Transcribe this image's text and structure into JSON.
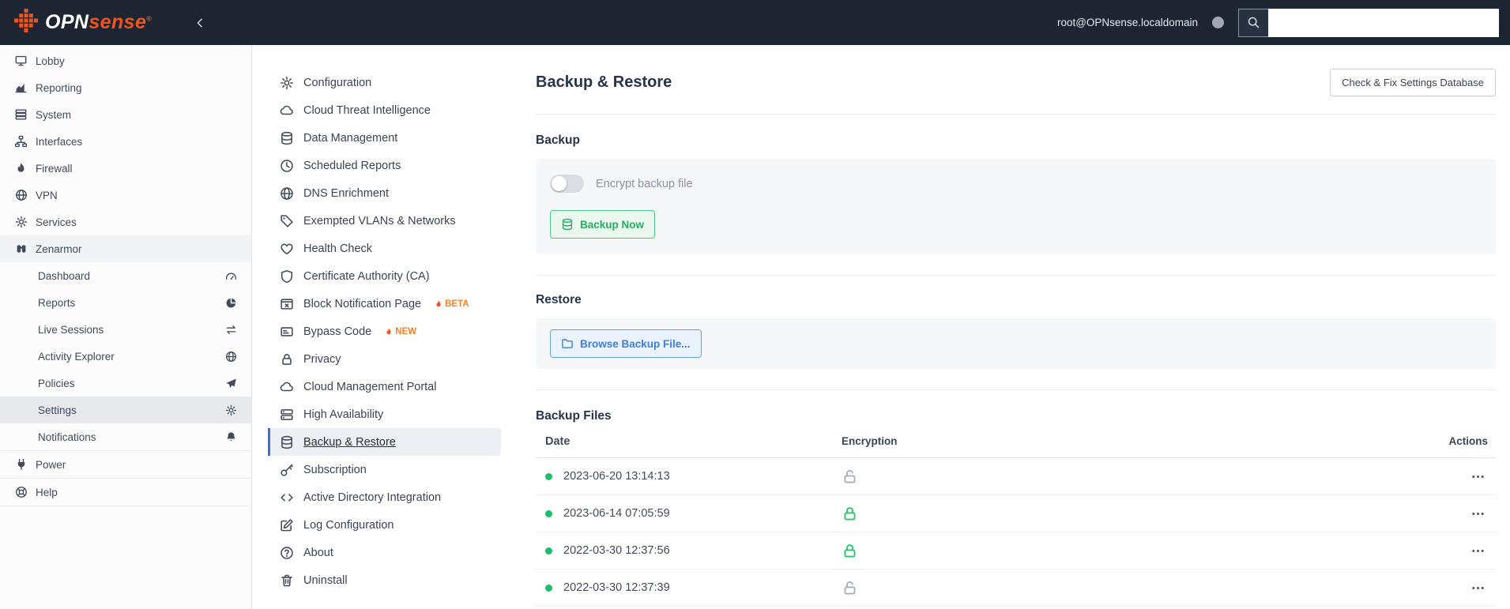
{
  "topbar": {
    "logo_opn": "OPN",
    "logo_sense": "sense",
    "logo_reg": "®",
    "user": "root@OPNsense.localdomain"
  },
  "sidebar": {
    "items": [
      {
        "label": "Lobby"
      },
      {
        "label": "Reporting"
      },
      {
        "label": "System"
      },
      {
        "label": "Interfaces"
      },
      {
        "label": "Firewall"
      },
      {
        "label": "VPN"
      },
      {
        "label": "Services"
      },
      {
        "label": "Zenarmor"
      },
      {
        "label": "Power"
      },
      {
        "label": "Help"
      }
    ],
    "zenarmor_children": [
      {
        "label": "Dashboard"
      },
      {
        "label": "Reports"
      },
      {
        "label": "Live Sessions"
      },
      {
        "label": "Activity Explorer"
      },
      {
        "label": "Policies"
      },
      {
        "label": "Settings"
      },
      {
        "label": "Notifications"
      }
    ]
  },
  "settings_menu": {
    "items": [
      {
        "label": "Configuration"
      },
      {
        "label": "Cloud Threat Intelligence"
      },
      {
        "label": "Data Management"
      },
      {
        "label": "Scheduled Reports"
      },
      {
        "label": "DNS Enrichment"
      },
      {
        "label": "Exempted VLANs & Networks"
      },
      {
        "label": "Health Check"
      },
      {
        "label": "Certificate Authority (CA)"
      },
      {
        "label": "Block Notification Page",
        "badge": "BETA"
      },
      {
        "label": "Bypass Code",
        "badge": "NEW"
      },
      {
        "label": "Privacy"
      },
      {
        "label": "Cloud Management Portal"
      },
      {
        "label": "High Availability"
      },
      {
        "label": "Backup & Restore"
      },
      {
        "label": "Subscription"
      },
      {
        "label": "Active Directory Integration"
      },
      {
        "label": "Log Configuration"
      },
      {
        "label": "About"
      },
      {
        "label": "Uninstall"
      }
    ]
  },
  "main": {
    "title": "Backup & Restore",
    "check_fix_button": "Check & Fix Settings Database",
    "backup_heading": "Backup",
    "encrypt_toggle_label": "Encrypt backup file",
    "backup_now_button": "Backup Now",
    "restore_heading": "Restore",
    "browse_button": "Browse Backup File...",
    "backup_files_heading": "Backup Files",
    "table": {
      "columns": [
        "Date",
        "Encryption",
        "Actions"
      ],
      "rows": [
        {
          "date": "2023-06-20 13:14:13",
          "encrypted": false
        },
        {
          "date": "2023-06-14 07:05:59",
          "encrypted": true
        },
        {
          "date": "2022-03-30 12:37:56",
          "encrypted": true
        },
        {
          "date": "2022-03-30 12:37:39",
          "encrypted": false
        }
      ]
    }
  },
  "colors": {
    "brand_orange": "#f0541e",
    "active_blue": "#3d6edb",
    "success_green": "#27c46f",
    "badge_orange": "#f58220"
  }
}
